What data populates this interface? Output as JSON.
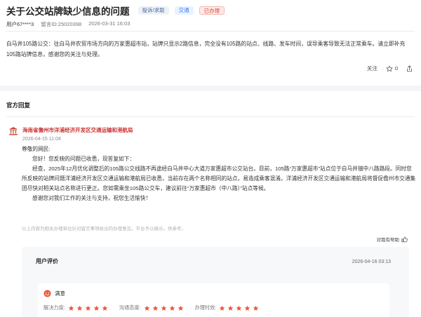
{
  "header": {
    "title": "关于公交站牌缺少信息的问题",
    "tags": [
      "投诉/求助",
      "交通",
      "已办理"
    ],
    "user": "用户67****3",
    "message_id": "留言ID:25020398",
    "posted_at": "2026-03-31 16:03"
  },
  "post": {
    "content": "白马井105路公交：往白马井农贸市场方向的万家惠超市站，站牌只显示2路信息，完全没有105路的站点、线路、发车时间，误导乘客导致无法正常乘车。请立即补充105路站牌信息，感谢您的关注与处理。",
    "follow_label": "关注",
    "favorite_count": "0"
  },
  "official": {
    "section_title": "官方回复",
    "org_name": "海南省儋州市洋浦经济开发区交通运输和港航局",
    "reply_date": "2026-04-15 11:04",
    "reply": {
      "greeting": "尊敬的网民:",
      "p1": "您好！您反映的问题已收悉，现答复如下：",
      "p2": "经查，2025年12月优化调整后的105路公交线路不再途经白马井中心大道万家惠超市公交站台。目前，105路“万家惠超市”站点位于白马井镇中八路路段。同时您所反映的站牌问题洋浦经济开发区交通运输和港航局已收悉，当前存在两个名称相同的站点，易造成乘客混淆。洋浦经济开发区交通运输和港航局将督促儋州市交通集团尽快对相关站点名称进行更正。您如需乘坐105路公交车，建议前往“万家惠超市（中八路）”站点等候。",
      "p3": "感谢您对我们工作的关注与支持，祝您生活愉快！"
    },
    "disclaimer": "以上内容为相关办理单位针对留言事项给出的办理意见，平台予以展示，供参考。",
    "helpful_label": "对我有帮助"
  },
  "evaluation": {
    "title": "用户评价",
    "date": "2026-04-16 03:13",
    "satisfaction": "满意",
    "scores": [
      {
        "label": "解决力度:",
        "stars": 5
      },
      {
        "label": "沟通态度:",
        "stars": 5
      },
      {
        "label": "办理时效:",
        "stars": 5
      }
    ]
  },
  "colors": {
    "star": "#f0553a",
    "org": "#cc3333",
    "tag_blue": "#2d7cf6",
    "tag_red": "#e04a3a"
  }
}
